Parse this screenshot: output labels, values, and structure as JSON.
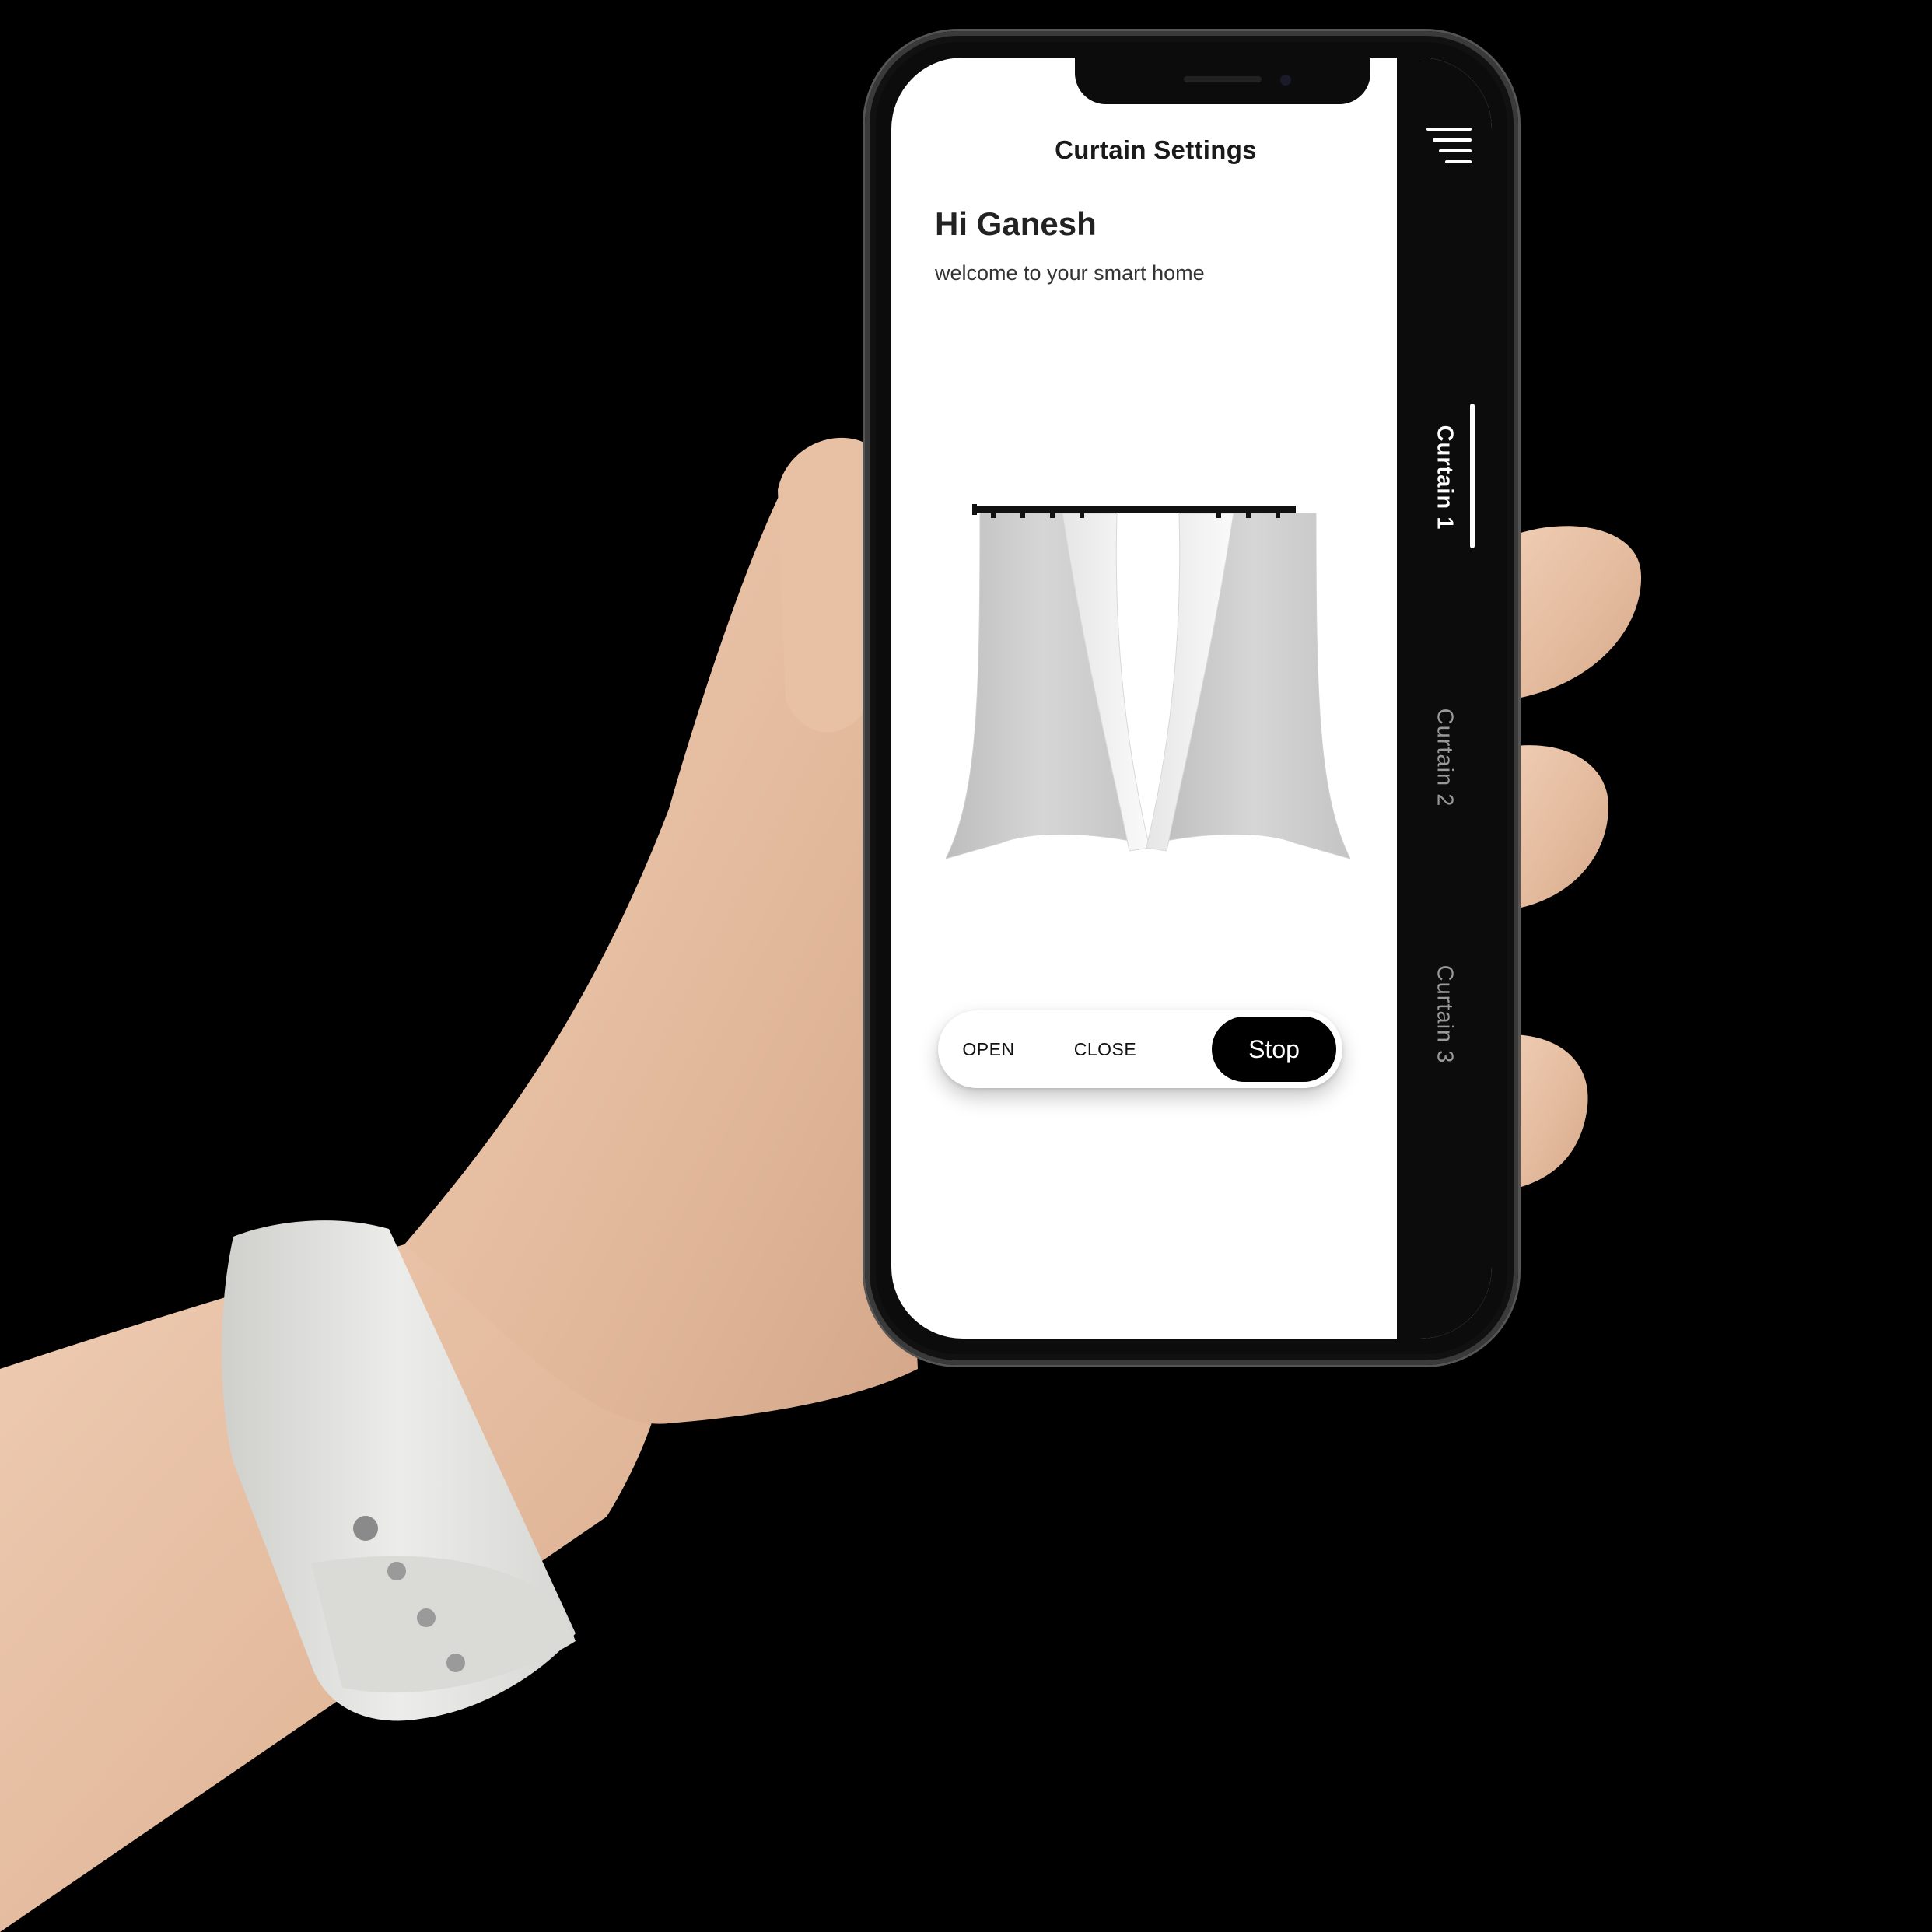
{
  "app": {
    "title": "Curtain Settings",
    "greeting": "Hi Ganesh",
    "subtitle": "welcome to your smart home"
  },
  "controls": {
    "open_label": "OPEN",
    "close_label": "CLOSE",
    "stop_label": "Stop",
    "selected": "Stop"
  },
  "sidebar": {
    "menu_icon": "hamburger-menu-icon",
    "tabs": [
      {
        "label": "Curtain 1",
        "active": true
      },
      {
        "label": "Curtain 2",
        "active": false
      },
      {
        "label": "Curtain 3",
        "active": false
      }
    ]
  },
  "colors": {
    "accent": "#000000",
    "screen_bg": "#ffffff",
    "sidebar_bg": "#0c0c0c",
    "skin": "#e8c2a8",
    "strap": "#e6e6e4"
  }
}
